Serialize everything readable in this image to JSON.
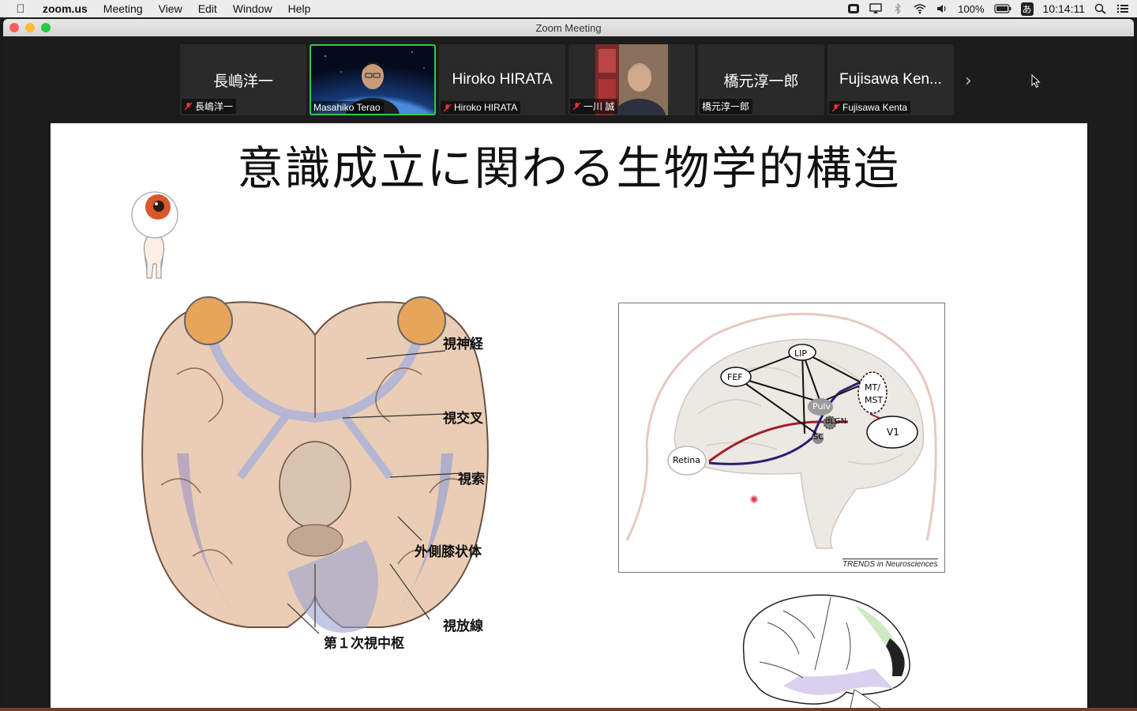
{
  "menubar": {
    "app": "zoom.us",
    "menus": [
      "Meeting",
      "View",
      "Edit",
      "Window",
      "Help"
    ],
    "battery": "100%",
    "input_method": "あ",
    "clock": "10:14:11"
  },
  "window": {
    "title": "Zoom Meeting"
  },
  "participants": [
    {
      "big": "長嶋洋一",
      "label": "長嶋洋一",
      "muted": true,
      "video": false
    },
    {
      "big": "",
      "label": "Masahiko Terao",
      "muted": false,
      "video": true,
      "active": true
    },
    {
      "big": "Hiroko HIRATA",
      "label": "Hiroko HIRATA",
      "muted": true,
      "video": false
    },
    {
      "big": "",
      "label": "一川 誠",
      "muted": true,
      "video": true
    },
    {
      "big": "橋元淳一郎",
      "label": "橋元淳一郎",
      "muted": false,
      "video": false
    },
    {
      "big": "Fujisawa Ken...",
      "label": "Fujisawa Kenta",
      "muted": true,
      "video": false
    }
  ],
  "slide": {
    "title": "意識成立に関わる生物学的構造",
    "labels": {
      "optic_nerve": "視神経",
      "chiasm": "視交叉",
      "tract": "視索",
      "lgn": "外側膝状体",
      "radiation": "視放線",
      "v1": "第１次視中枢"
    },
    "diagram": {
      "nodes": {
        "lip": "LIP",
        "fef": "FEF",
        "mt": "MT/",
        "mst": "MST",
        "pulv": "Pulv",
        "dlgn": "dLGN",
        "sc": "SC",
        "v1": "V1",
        "retina": "Retina"
      },
      "credit": "TRENDS in Neurosciences"
    }
  }
}
